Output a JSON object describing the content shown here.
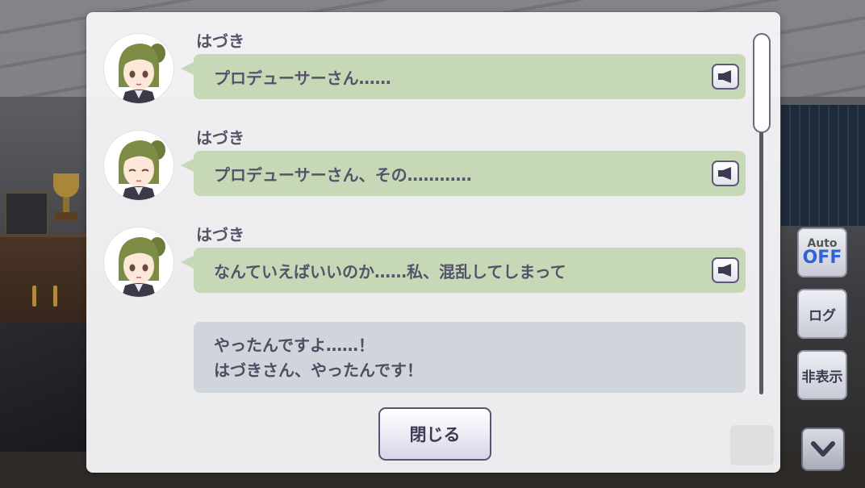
{
  "backlog": {
    "entries": [
      {
        "speaker": "はづき",
        "text": "プロデューサーさん……",
        "voice_icon": "speaker-icon"
      },
      {
        "speaker": "はづき",
        "text": "プロデューサーさん、その…………",
        "voice_icon": "speaker-icon"
      },
      {
        "speaker": "はづき",
        "text": "なんていえばいいのか……私、混乱してしまって",
        "voice_icon": "speaker-icon"
      }
    ],
    "player_line_1": "やったんですよ……！",
    "player_line_2": "はづきさん、やったんです！",
    "close_label": "閉じる"
  },
  "controls": {
    "auto_label": "Auto",
    "auto_state": "OFF",
    "log_label": "ログ",
    "hide_label": "非表示"
  },
  "colors": {
    "speaker_bubble": "#c7d8b6",
    "player_bubble": "#d0d4db",
    "auto_off": "#2f63d6"
  }
}
